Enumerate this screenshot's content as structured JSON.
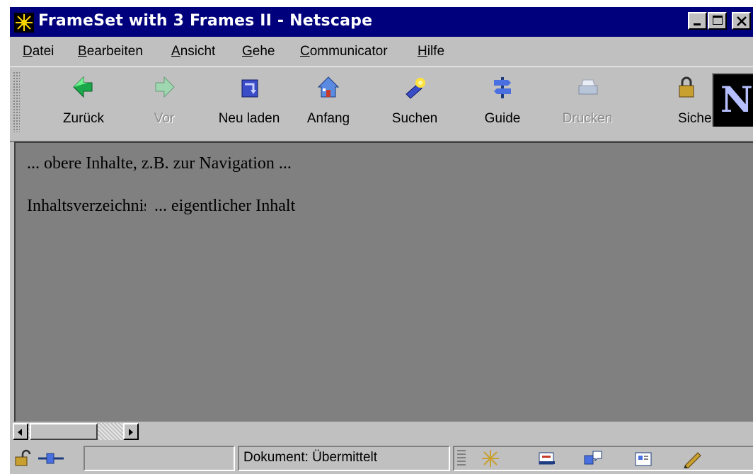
{
  "window": {
    "title": "FrameSet with 3 Frames II - Netscape",
    "controls": [
      "minimize",
      "maximize",
      "close"
    ]
  },
  "menu": [
    {
      "label": "Datei",
      "mnemonic": "D",
      "rest": "atei"
    },
    {
      "label": "Bearbeiten",
      "mnemonic": "B",
      "rest": "earbeiten"
    },
    {
      "label": "Ansicht",
      "mnemonic": "A",
      "rest": "nsicht"
    },
    {
      "label": "Gehe",
      "mnemonic": "G",
      "rest": "ehe"
    },
    {
      "label": "Communicator",
      "mnemonic": "C",
      "rest": "ommunicator"
    },
    {
      "label": "Hilfe",
      "mnemonic": "H",
      "rest": "ilfe"
    }
  ],
  "toolbar": {
    "back": {
      "label": "Zurück",
      "icon": "back-arrow-icon"
    },
    "forward": {
      "label": "Vor",
      "icon": "forward-arrow-icon",
      "disabled": true
    },
    "reload": {
      "label": "Neu laden",
      "icon": "reload-icon"
    },
    "home": {
      "label": "Anfang",
      "icon": "home-icon"
    },
    "search": {
      "label": "Suchen",
      "icon": "search-flashlight-icon"
    },
    "guide": {
      "label": "Guide",
      "icon": "signpost-icon"
    },
    "print": {
      "label": "Drucken",
      "icon": "printer-icon",
      "disabled": true
    },
    "security": {
      "label": "Siche",
      "icon": "padlock-icon"
    },
    "logo": {
      "letter": "N"
    }
  },
  "content": {
    "top_frame_text": "... obere Inhalte, z.B. zur Navigation ...",
    "left_frame_text": "Inhaltsverzeichnis",
    "main_frame_text": "... eigentlicher Inhalt",
    "background": "#808080"
  },
  "status": {
    "text": "Dokument: Übermittelt"
  },
  "colors": {
    "titlebar": "#00007d",
    "chrome": "#c0c0c0"
  }
}
